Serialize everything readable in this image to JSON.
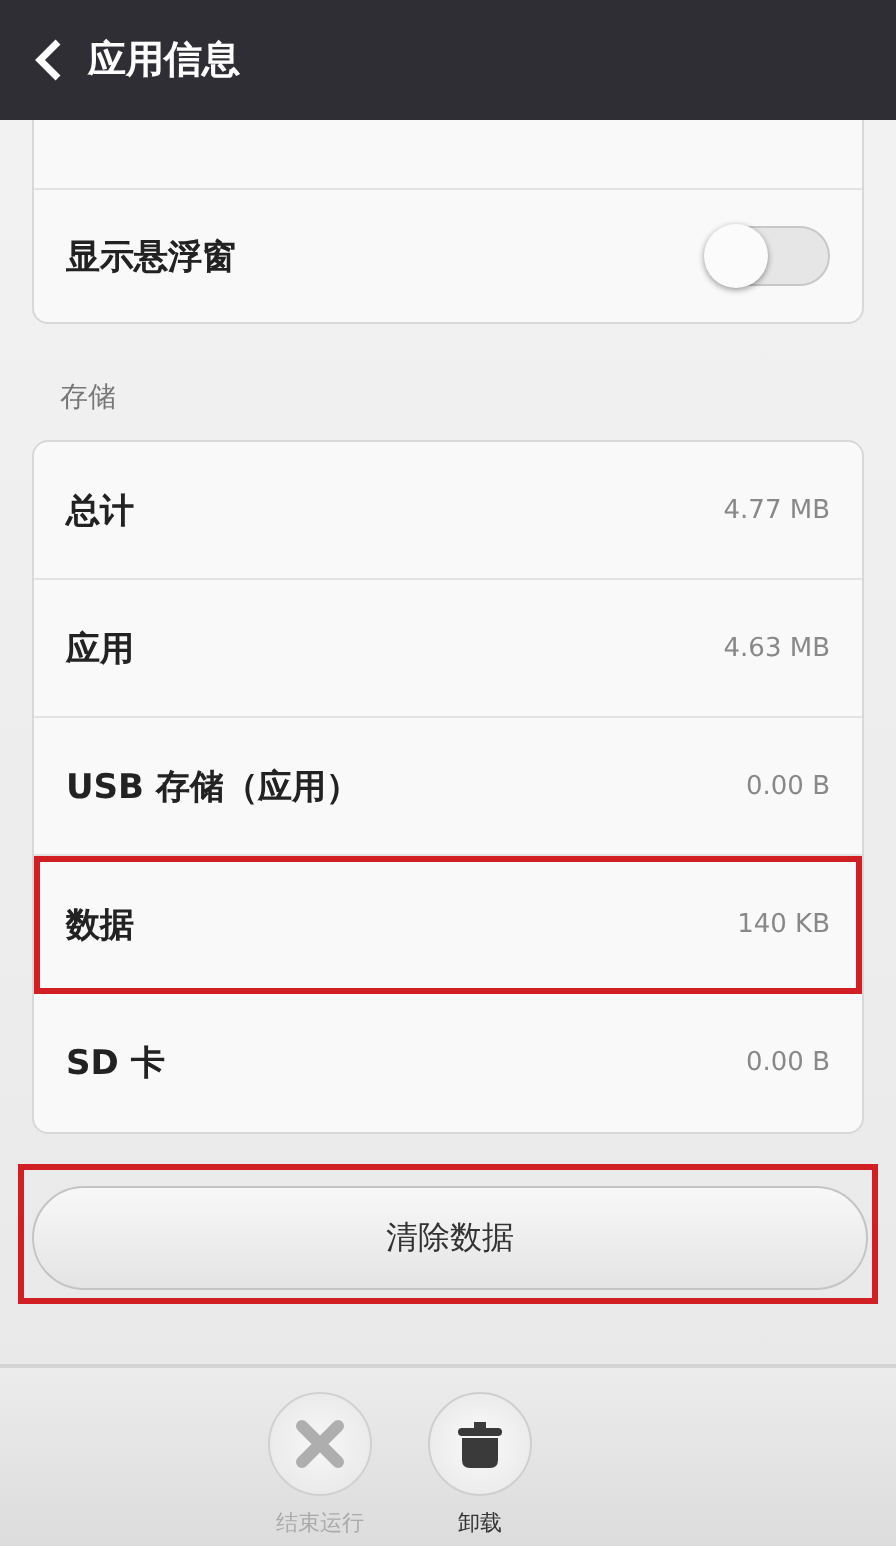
{
  "header": {
    "title": "应用信息"
  },
  "settings": [
    {
      "kind": "toggle",
      "label": "显示悬浮窗",
      "on": false
    }
  ],
  "storage": {
    "section_label": "存储",
    "rows": [
      {
        "label": "总计",
        "value": "4.77 MB",
        "highlighted": false
      },
      {
        "label": "应用",
        "value": "4.63 MB",
        "highlighted": false
      },
      {
        "label": "USB 存储（应用）",
        "value": "0.00 B",
        "highlighted": false
      },
      {
        "label": "数据",
        "value": "140 KB",
        "highlighted": true
      },
      {
        "label": "SD 卡",
        "value": "0.00 B",
        "highlighted": false
      }
    ]
  },
  "clear_button": {
    "label": "清除数据",
    "highlighted": true
  },
  "bottom_actions": [
    {
      "kind": "stop",
      "label": "结束运行",
      "disabled": true
    },
    {
      "kind": "uninstall",
      "label": "卸载",
      "disabled": false
    }
  ]
}
